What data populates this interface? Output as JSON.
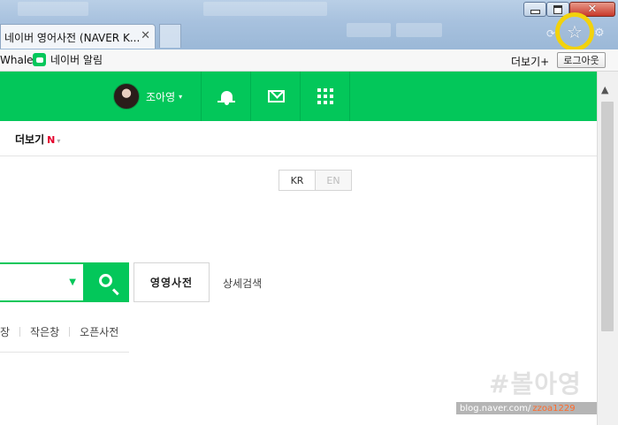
{
  "browser": {
    "tab_title": "네이버 영어사전 (NAVER K...",
    "tab_close": "✕",
    "window_buttons": {
      "minimize": "",
      "maximize": "",
      "close": "✕"
    },
    "star_icon": "☆"
  },
  "bookmarks": {
    "whale": "Whale",
    "alarm": "네이버 알림",
    "more": "더보기+",
    "logout": "로그아웃"
  },
  "gnb": {
    "profile_name": "조아영",
    "profile_caret": "▾",
    "accent": "#03c75a"
  },
  "subnav": {
    "more": "더보기",
    "new_badge": "N",
    "caret": "▾"
  },
  "lang": {
    "kr": "KR",
    "en": "EN"
  },
  "search": {
    "dropdown_caret": "▼",
    "dict_button": "영영사전",
    "detail_link": "상세검색"
  },
  "quick_links": [
    "장",
    "작은창",
    "오픈사전"
  ],
  "scrollbar": {
    "up_arrow": "▲"
  },
  "watermark": {
    "name": "#볼아영",
    "url": "blog.naver.com/",
    "user": "zzoa1229"
  }
}
